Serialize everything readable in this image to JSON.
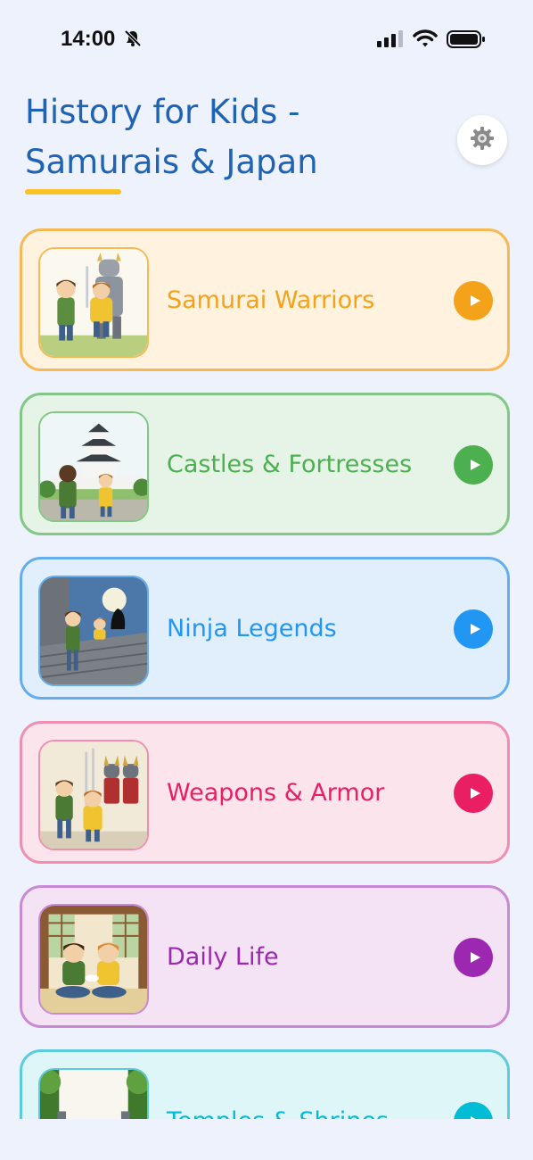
{
  "status": {
    "time": "14:00"
  },
  "header": {
    "title": "History for Kids - Samurais & Japan"
  },
  "topics": [
    {
      "label": "Samurai Warriors",
      "accent": "#f5a21b",
      "bg": "#fff2df",
      "border": "#f7b955",
      "thumb_icon": "samurai-warriors-illustration"
    },
    {
      "label": "Castles & Fortresses",
      "accent": "#4caf50",
      "bg": "#e6f4e7",
      "border": "#82c785",
      "thumb_icon": "castle-illustration"
    },
    {
      "label": "Ninja Legends",
      "accent": "#2196f3",
      "bg": "#e1effc",
      "border": "#64aeee",
      "thumb_icon": "ninja-illustration"
    },
    {
      "label": "Weapons & Armor",
      "accent": "#e91e63",
      "bg": "#fce4ec",
      "border": "#ef8fb0",
      "thumb_icon": "weapons-armor-illustration"
    },
    {
      "label": "Daily Life",
      "accent": "#9c27b0",
      "bg": "#f4e3f5",
      "border": "#c98ad3",
      "thumb_icon": "daily-life-illustration"
    },
    {
      "label": "Temples & Shrines",
      "accent": "#00bcd4",
      "bg": "#dff6f9",
      "border": "#5ccbdc",
      "thumb_icon": "temple-illustration"
    }
  ]
}
